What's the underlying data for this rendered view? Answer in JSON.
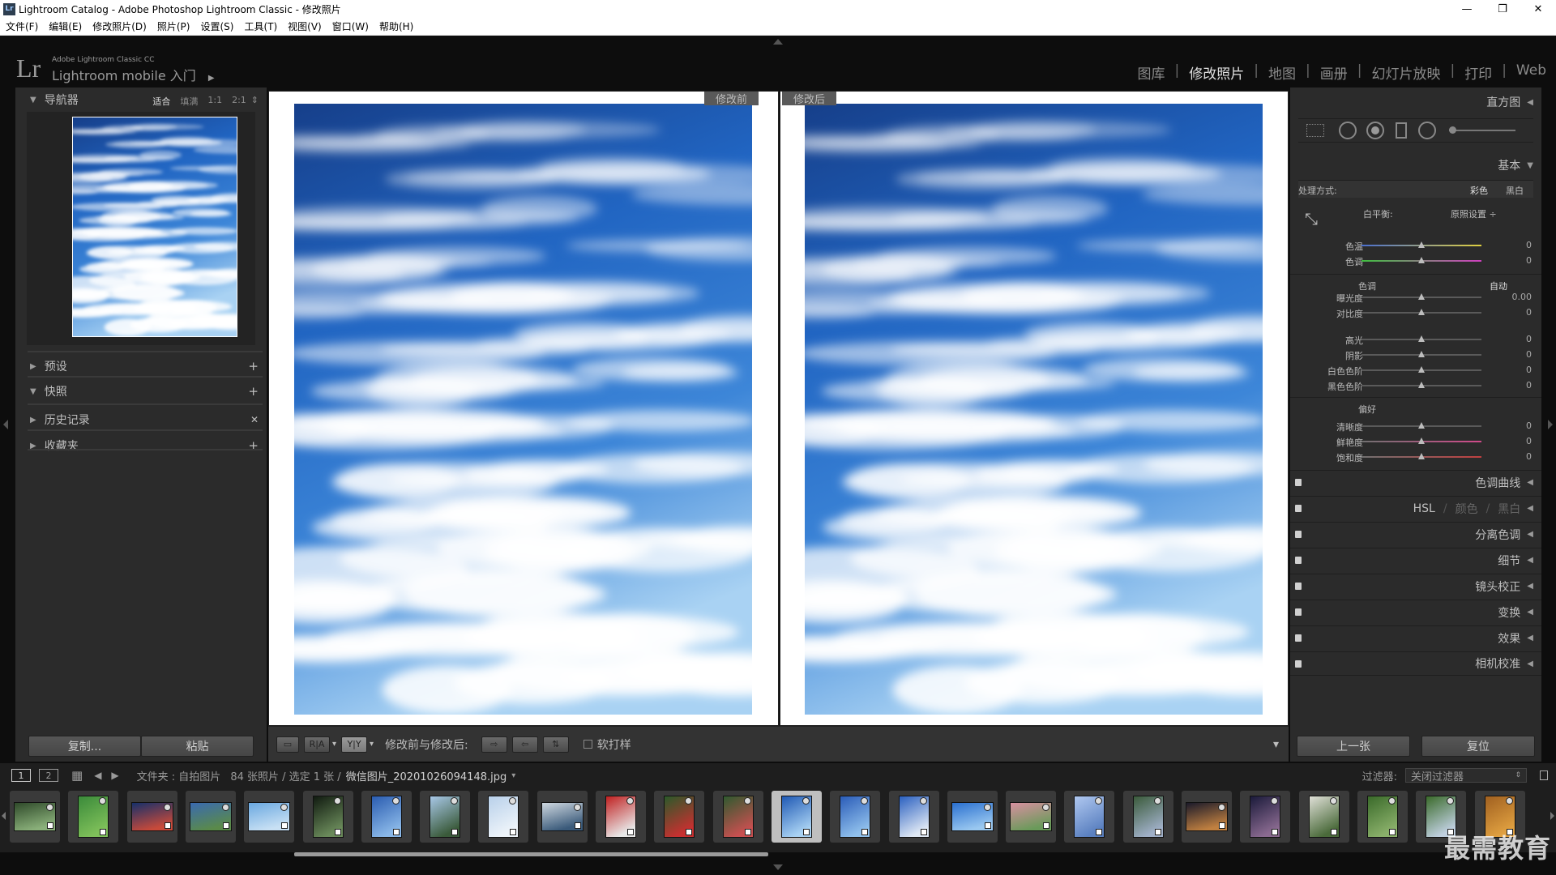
{
  "window": {
    "title": "Lightroom Catalog - Adobe Photoshop Lightroom Classic - 修改照片",
    "app_icon": "Lr",
    "minimize": "—",
    "maximize": "❐",
    "close": "✕"
  },
  "menu": [
    "文件(F)",
    "编辑(E)",
    "修改照片(D)",
    "照片(P)",
    "设置(S)",
    "工具(T)",
    "视图(V)",
    "窗口(W)",
    "帮助(H)"
  ],
  "identity": {
    "logo": "Lr",
    "line1": "Adobe Lightroom Classic CC",
    "line2": "Lightroom mobile 入门",
    "arrow": "▶"
  },
  "modules": [
    {
      "label": "图库",
      "active": false
    },
    {
      "label": "修改照片",
      "active": true
    },
    {
      "label": "地图",
      "active": false
    },
    {
      "label": "画册",
      "active": false
    },
    {
      "label": "幻灯片放映",
      "active": false
    },
    {
      "label": "打印",
      "active": false
    },
    {
      "label": "Web",
      "active": false
    }
  ],
  "left_panel": {
    "navigator": {
      "title": "导航器",
      "zoom": [
        "适合",
        "填满",
        "1:1",
        "2:1"
      ],
      "zoom_active": "适合",
      "zoom_arrow": "⇕"
    },
    "presets": {
      "title": "预设",
      "action": "+"
    },
    "snapshots": {
      "title": "快照",
      "action": "+"
    },
    "history": {
      "title": "历史记录",
      "action": "✕"
    },
    "collections": {
      "title": "收藏夹",
      "action": "+"
    },
    "copy_button": "复制...",
    "paste_button": "粘贴"
  },
  "center": {
    "before_label": "修改前",
    "after_label": "修改后"
  },
  "toolbar": {
    "compare_label": "修改前与修改后:",
    "softproof_label": "软打样",
    "view_loupe": "▭",
    "view_ra": "R|A",
    "view_yy": "Y|Y",
    "dropdown": "▾"
  },
  "right_panel": {
    "histogram_title": "直方图",
    "basic_title": "基本",
    "treatment_label": "处理方式:",
    "treatment_color": "彩色",
    "treatment_bw": "黑白",
    "wb_label": "白平衡:",
    "wb_value": "原照设置 ÷",
    "wb_sliders": [
      {
        "label": "色温",
        "value": "0",
        "pos": 0.5
      },
      {
        "label": "色调",
        "value": "0",
        "pos": 0.5
      }
    ],
    "tone_label": "色调",
    "tone_auto": "自动",
    "tone_sliders": [
      {
        "label": "曝光度",
        "value": "0.00",
        "pos": 0.5
      },
      {
        "label": "对比度",
        "value": "0",
        "pos": 0.5
      }
    ],
    "tone_sliders2": [
      {
        "label": "高光",
        "value": "0",
        "pos": 0.5
      },
      {
        "label": "阴影",
        "value": "0",
        "pos": 0.5
      },
      {
        "label": "白色色阶",
        "value": "0",
        "pos": 0.5
      },
      {
        "label": "黑色色阶",
        "value": "0",
        "pos": 0.5
      }
    ],
    "presence_label": "偏好",
    "presence_sliders": [
      {
        "label": "清晰度",
        "value": "0",
        "pos": 0.5
      },
      {
        "label": "鲜艳度",
        "value": "0",
        "pos": 0.5
      },
      {
        "label": "饱和度",
        "value": "0",
        "pos": 0.5
      }
    ],
    "sections": [
      "色调曲线",
      "HSL / 颜色 / 黑白",
      "分离色调",
      "细节",
      "镜头校正",
      "变换",
      "效果",
      "相机校准"
    ],
    "hsl_parts": [
      "HSL",
      "颜色",
      "黑白"
    ],
    "prev_button": "上一张",
    "reset_button": "复位"
  },
  "filmbar": {
    "page1": "1",
    "page2": "2",
    "grid_icon": "▦",
    "back": "◀",
    "forward": "▶",
    "source": "文件夹 : 自拍图片",
    "count": "84 张照片 / 选定 1 张 /",
    "filename": "微信图片_20201026094148.jpg",
    "filename_arrow": "▾",
    "filter_label": "过滤器:",
    "filter_value": "关闭过滤器"
  },
  "filmstrip": {
    "selected_index": 13,
    "count": 26
  },
  "watermark": "最需教育",
  "colors": {
    "panel_bg": "#2b2b2b",
    "sky_deep": "#1f59b4",
    "sky_light": "#8cc0f0"
  }
}
